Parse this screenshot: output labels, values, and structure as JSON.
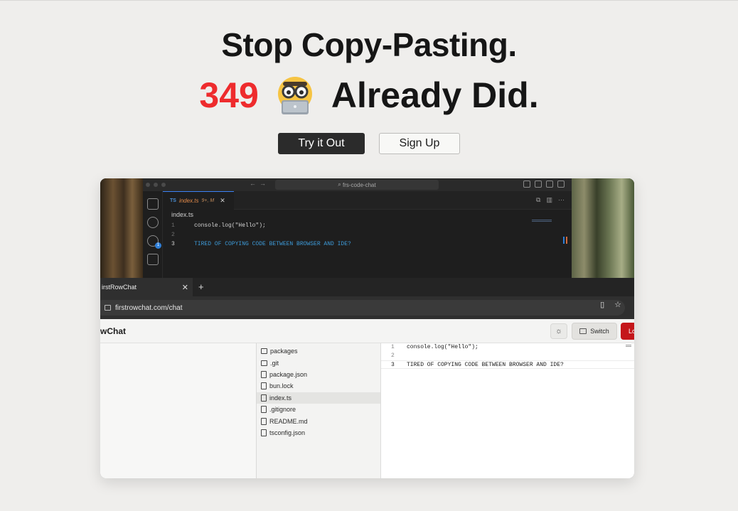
{
  "hero": {
    "line1": "Stop Copy-Pasting.",
    "count": "349",
    "suffix": "Already Did.",
    "emoji_icon": "nerd-face-laptop-icon"
  },
  "cta": {
    "try_label": "Try it Out",
    "signup_label": "Sign Up"
  },
  "vscode": {
    "search_text": "frs-code-chat",
    "tab_lang": "TS",
    "tab_name": "index.ts",
    "tab_modified": "9+, M",
    "breadcrumb": "index.ts",
    "scm_badge": "1",
    "lines": [
      {
        "n": "1",
        "text": "console.log(\"Hello\");"
      },
      {
        "n": "2",
        "text": ""
      },
      {
        "n": "3",
        "text": "TIRED OF COPYING CODE BETWEEN BROWSER AND IDE?"
      }
    ]
  },
  "browser": {
    "tab_title": "irstRowChat",
    "url": "firstrowchat.com/chat"
  },
  "app": {
    "brand": "wChat",
    "switch_label": "Switch",
    "logout_label": "Lo",
    "files": [
      {
        "name": "packages",
        "type": "folder",
        "selected": false
      },
      {
        "name": ".git",
        "type": "folder",
        "selected": false
      },
      {
        "name": "package.json",
        "type": "file",
        "selected": false
      },
      {
        "name": "bun.lock",
        "type": "file",
        "selected": false
      },
      {
        "name": "index.ts",
        "type": "file",
        "selected": true
      },
      {
        "name": ".gitignore",
        "type": "file",
        "selected": false
      },
      {
        "name": "README.md",
        "type": "file",
        "selected": false
      },
      {
        "name": "tsconfig.json",
        "type": "file",
        "selected": false
      }
    ],
    "editor_lines": [
      {
        "n": "1",
        "text": "console.log(\"Hello\");"
      },
      {
        "n": "2",
        "text": ""
      },
      {
        "n": "3",
        "text": "TIRED OF COPYING CODE BETWEEN BROWSER AND IDE?"
      }
    ]
  },
  "colors": {
    "accent_red": "#ee2b2d",
    "dark_button": "#2b2b2b",
    "logout_red": "#c4161b",
    "vscode_blue": "#3d9ad8"
  }
}
